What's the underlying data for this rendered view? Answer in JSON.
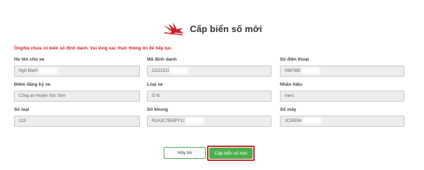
{
  "header": {
    "title": "Cấp biển số mới",
    "icon": "red-bird-logo-icon"
  },
  "warning": "Ông/bà chưa có biển số định danh. Vui lòng xác thực thông tin để tiếp tục.",
  "fields": {
    "owner_name": {
      "label": "Họ tên chủ xe",
      "value": "Ngô Mạnh"
    },
    "id_code": {
      "label": "Mã định danh",
      "value": "11122211"
    },
    "phone": {
      "label": "Số điện thoại",
      "value": "0967882"
    },
    "registration_place": {
      "label": "Điểm đăng ký xe",
      "value": "Công an Huyện Sóc Sơn"
    },
    "vehicle_type": {
      "label": "Loại xe",
      "value": "Ô tô"
    },
    "brand": {
      "label": "Nhãn hiệu",
      "value": "merc"
    },
    "type_number": {
      "label": "Số loại",
      "value": "123"
    },
    "chassis_number": {
      "label": "Số khung",
      "value": "RLHJC7559PY12"
    },
    "engine_number": {
      "label": "Số máy",
      "value": "JC50E64"
    }
  },
  "buttons": {
    "cancel": "Hủy bỏ",
    "submit": "Cấp biển số mới"
  },
  "colors": {
    "warning": "#d42323",
    "primary": "#4cae4c",
    "highlight": "#c9232d"
  }
}
